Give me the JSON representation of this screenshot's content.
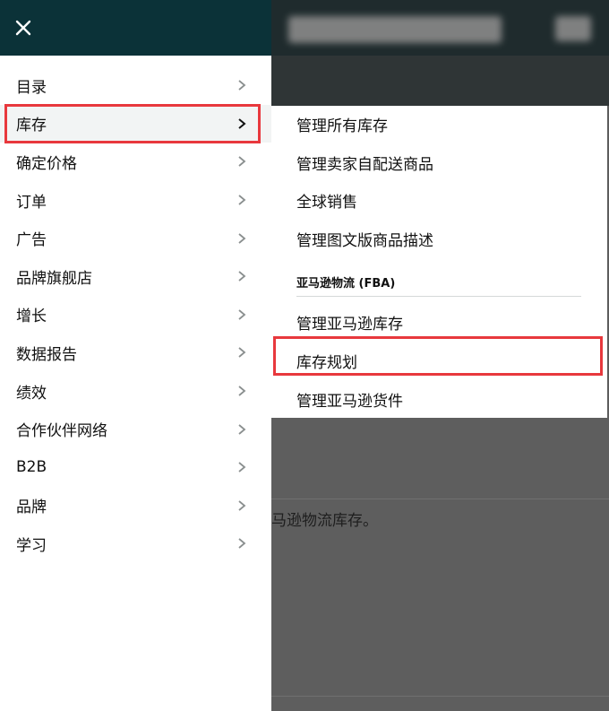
{
  "background": {
    "snippet_text": "马逊物流库存。"
  },
  "drawer": {
    "close_icon": "close-icon",
    "items": [
      {
        "label": "目录"
      },
      {
        "label": "库存"
      },
      {
        "label": "确定价格"
      },
      {
        "label": "订单"
      },
      {
        "label": "广告"
      },
      {
        "label": "品牌旗舰店"
      },
      {
        "label": "增长"
      },
      {
        "label": "数据报告"
      },
      {
        "label": "绩效"
      },
      {
        "label": "合作伙伴网络"
      },
      {
        "label": "B2B"
      },
      {
        "label": "品牌"
      },
      {
        "label": "学习"
      }
    ],
    "active_index": 1
  },
  "flyout": {
    "items": [
      {
        "label": "管理所有库存"
      },
      {
        "label": "管理卖家自配送商品"
      },
      {
        "label": "全球销售"
      },
      {
        "label": "管理图文版商品描述"
      }
    ],
    "fba_section_title": "亚马逊物流 (FBA)",
    "fba_items": [
      {
        "label": "管理亚马逊库存"
      },
      {
        "label": "库存规划"
      },
      {
        "label": "管理亚马逊货件"
      }
    ]
  },
  "colors": {
    "header_bg": "#0b3238",
    "highlight_border": "#e8383d",
    "overlay_bg": "#5e5e5e"
  }
}
